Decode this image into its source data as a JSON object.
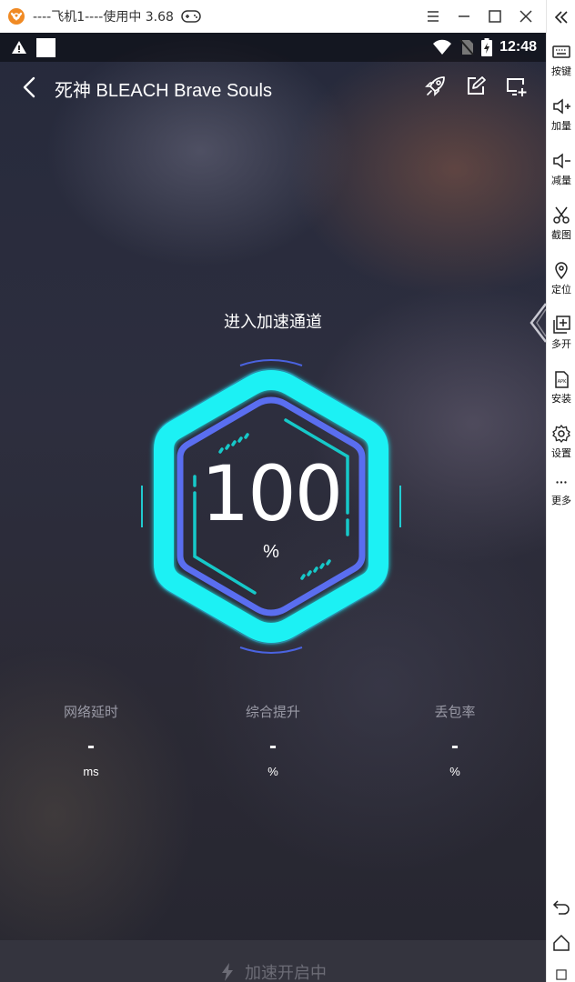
{
  "window": {
    "title": "----飞机1----使用中 3.68"
  },
  "toolbar": {
    "items": [
      {
        "label": "按键",
        "icon": "keyboard-icon"
      },
      {
        "label": "加量",
        "icon": "volume-up-icon"
      },
      {
        "label": "减量",
        "icon": "volume-down-icon"
      },
      {
        "label": "截图",
        "icon": "scissors-icon"
      },
      {
        "label": "定位",
        "icon": "location-icon"
      },
      {
        "label": "多开",
        "icon": "multi-instance-icon"
      },
      {
        "label": "安装",
        "icon": "apk-install-icon"
      },
      {
        "label": "设置",
        "icon": "gear-icon"
      },
      {
        "label": "更多",
        "icon": "more-icon"
      }
    ]
  },
  "statusbar": {
    "time": "12:48"
  },
  "appbar": {
    "title": "死神 BLEACH Brave Souls"
  },
  "main": {
    "status_text": "进入加速通道",
    "progress_value": "100",
    "progress_unit": "%",
    "progress_fraction": 1.0
  },
  "stats": [
    {
      "label": "网络延时",
      "value": "-",
      "unit": "ms"
    },
    {
      "label": "综合提升",
      "value": "-",
      "unit": "%"
    },
    {
      "label": "丢包率",
      "value": "-",
      "unit": "%"
    }
  ],
  "bottom_button": {
    "label": "加速开启中"
  },
  "colors": {
    "gauge_outer": "#1ff1f4",
    "gauge_inner": "#5a6ef0",
    "accent_dash": "#16c9c9"
  }
}
